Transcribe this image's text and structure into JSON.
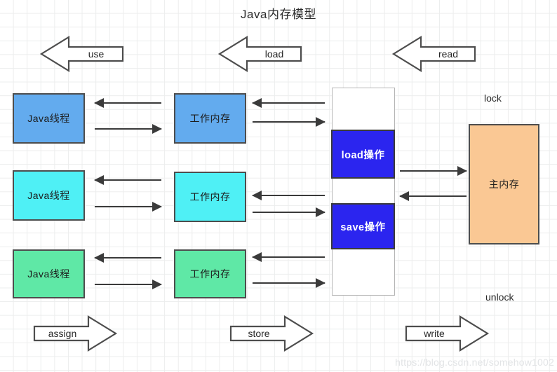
{
  "diagram": {
    "title": "Java内存模型",
    "watermark": "https://blog.csdn.net/somehow1002"
  },
  "top_arrows": [
    {
      "label": "use",
      "direction": "left"
    },
    {
      "label": "load",
      "direction": "left"
    },
    {
      "label": "read",
      "direction": "left"
    }
  ],
  "bottom_arrows": [
    {
      "label": "assign",
      "direction": "right"
    },
    {
      "label": "store",
      "direction": "right"
    },
    {
      "label": "write",
      "direction": "right"
    }
  ],
  "threads": [
    {
      "label": "Java线程",
      "color": "#63abee"
    },
    {
      "label": "Java线程",
      "color": "#4ff0f5"
    },
    {
      "label": "Java线程",
      "color": "#5fe8a6"
    }
  ],
  "working_memories": [
    {
      "label": "工作内存",
      "color": "#63abee"
    },
    {
      "label": "工作内存",
      "color": "#4ff0f5"
    },
    {
      "label": "工作内存",
      "color": "#5fe8a6"
    }
  ],
  "operations": {
    "column_background": "#ffffff",
    "items": [
      {
        "label": "load操作",
        "color": "#2b25ef"
      },
      {
        "label": "save操作",
        "color": "#2b25ef"
      }
    ]
  },
  "main_memory": {
    "label": "主内存",
    "color": "#fac894",
    "lock_label": "lock",
    "unlock_label": "unlock"
  }
}
